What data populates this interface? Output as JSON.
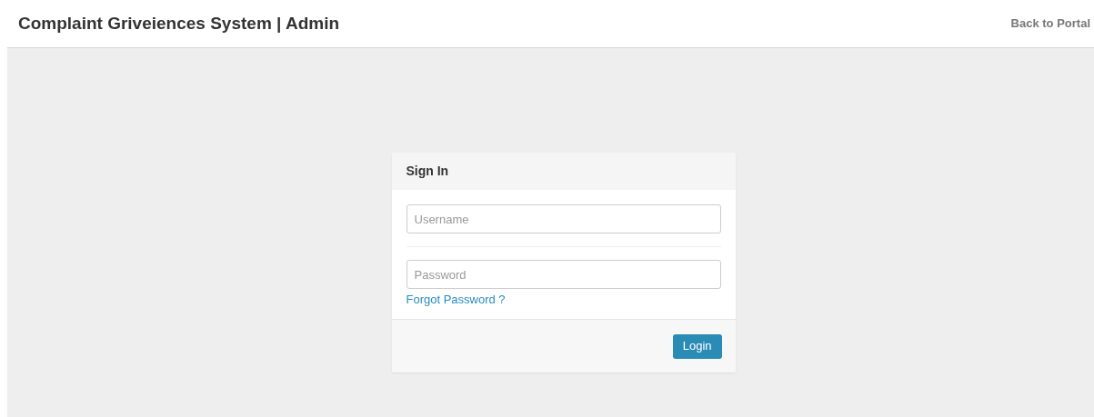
{
  "header": {
    "title": "Complaint Griveiences System | Admin",
    "link": "Back to Portal"
  },
  "login_panel": {
    "title": "Sign In",
    "username": {
      "placeholder": "Username"
    },
    "password": {
      "placeholder": "Password"
    },
    "forgot_link": "Forgot Password ?",
    "button": "Login"
  }
}
